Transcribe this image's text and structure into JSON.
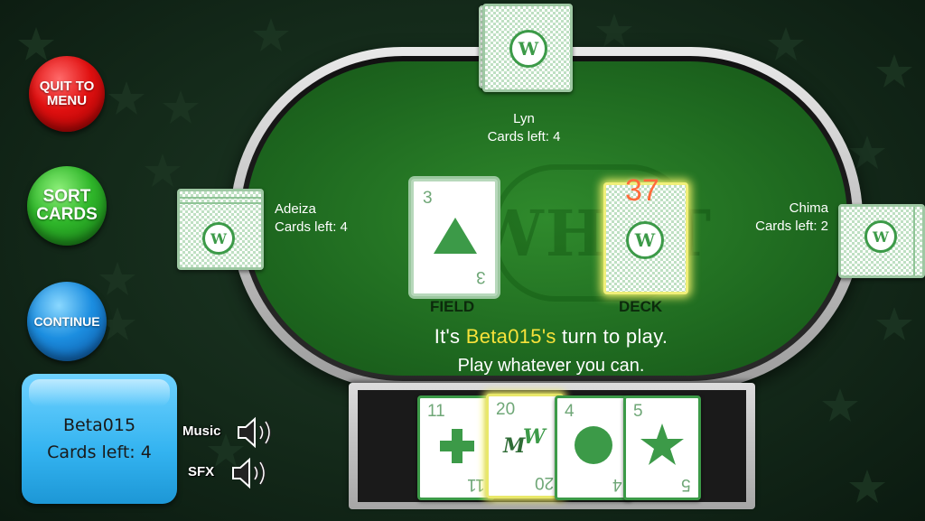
{
  "menu": {
    "quit_label": "QUIT TO\nMENU",
    "sort_label": "SORT\nCARDS",
    "continue_label": "CONTINUE"
  },
  "opponents": {
    "top": {
      "name": "Lyn",
      "cards_left": "Cards left: 4"
    },
    "left": {
      "name": "Adeiza",
      "cards_left": "Cards left: 4"
    },
    "right": {
      "name": "Chima",
      "cards_left": "Cards left: 2"
    }
  },
  "table": {
    "watermark": "WHOT",
    "field_label": "FIELD",
    "deck_label": "DECK",
    "deck_count": "37",
    "field_card": {
      "number": "3",
      "shape": "triangle"
    },
    "deck_badge": "W",
    "card_back_badge": "W"
  },
  "status": {
    "turn_prefix": "It's ",
    "turn_player": "Beta015's",
    "turn_suffix": " turn to play.",
    "hint": "Play whatever you can."
  },
  "player": {
    "name": "Beta015",
    "cards_left": "Cards left: 4"
  },
  "audio": {
    "music_label": "Music",
    "sfx_label": "SFX",
    "music_icon": "speaker-icon",
    "sfx_icon": "speaker-icon"
  },
  "hand": [
    {
      "number": "11",
      "shape": "cross"
    },
    {
      "number": "20",
      "shape": "whot",
      "badge": "W",
      "highlighted": true
    },
    {
      "number": "4",
      "shape": "circle"
    },
    {
      "number": "5",
      "shape": "star"
    }
  ],
  "colors": {
    "felt": "#2f8a2c",
    "card_green": "#3c9a48",
    "highlight": "#f7e23a",
    "deck_count": "#ff6b3a"
  }
}
